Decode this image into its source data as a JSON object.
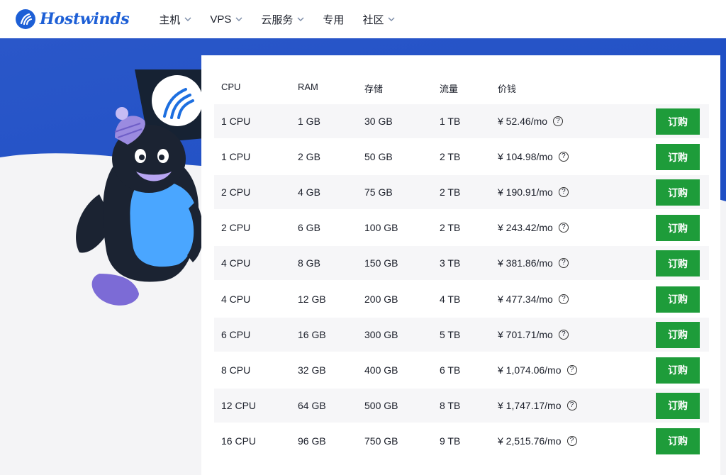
{
  "brand": {
    "name": "Hostwinds",
    "primary_color": "#1d5fd6",
    "accent_green": "#1e9c3a"
  },
  "nav": [
    {
      "label": "主机",
      "has_dropdown": true
    },
    {
      "label": "VPS",
      "has_dropdown": true
    },
    {
      "label": "云服务",
      "has_dropdown": true
    },
    {
      "label": "专用",
      "has_dropdown": false
    },
    {
      "label": "社区",
      "has_dropdown": true
    }
  ],
  "table": {
    "headers": {
      "cpu": "CPU",
      "ram": "RAM",
      "storage": "存储",
      "traffic": "流量",
      "price": "价钱"
    },
    "order_label": "订购",
    "help_glyph": "?",
    "rows": [
      {
        "cpu": "1 CPU",
        "ram": "1 GB",
        "storage": "30 GB",
        "traffic": "1 TB",
        "price": "¥ 52.46/mo"
      },
      {
        "cpu": "1 CPU",
        "ram": "2 GB",
        "storage": "50 GB",
        "traffic": "2 TB",
        "price": "¥ 104.98/mo"
      },
      {
        "cpu": "2 CPU",
        "ram": "4 GB",
        "storage": "75 GB",
        "traffic": "2 TB",
        "price": "¥ 190.91/mo"
      },
      {
        "cpu": "2 CPU",
        "ram": "6 GB",
        "storage": "100 GB",
        "traffic": "2 TB",
        "price": "¥ 243.42/mo"
      },
      {
        "cpu": "4 CPU",
        "ram": "8 GB",
        "storage": "150 GB",
        "traffic": "3 TB",
        "price": "¥ 381.86/mo"
      },
      {
        "cpu": "4 CPU",
        "ram": "12 GB",
        "storage": "200 GB",
        "traffic": "4 TB",
        "price": "¥ 477.34/mo"
      },
      {
        "cpu": "6 CPU",
        "ram": "16 GB",
        "storage": "300 GB",
        "traffic": "5 TB",
        "price": "¥ 701.71/mo"
      },
      {
        "cpu": "8 CPU",
        "ram": "32 GB",
        "storage": "400 GB",
        "traffic": "6 TB",
        "price": "¥ 1,074.06/mo"
      },
      {
        "cpu": "12 CPU",
        "ram": "64 GB",
        "storage": "500 GB",
        "traffic": "8 TB",
        "price": "¥ 1,747.17/mo"
      },
      {
        "cpu": "16 CPU",
        "ram": "96 GB",
        "storage": "750 GB",
        "traffic": "9 TB",
        "price": "¥ 2,515.76/mo"
      }
    ]
  }
}
